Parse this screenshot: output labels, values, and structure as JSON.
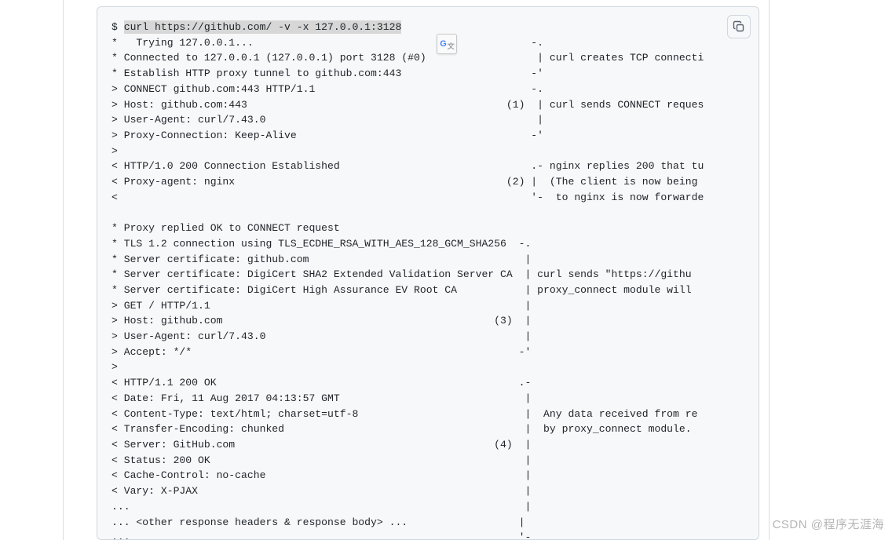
{
  "prompt": "$ ",
  "command_highlight": "curl https://github.com/ -v -x 127.0.0.1:3128",
  "terminal_lines": [
    "*   Trying 127.0.0.1...                                             -.",
    "* Connected to 127.0.0.1 (127.0.0.1) port 3128 (#0)                  | curl creates TCP connecti",
    "* Establish HTTP proxy tunnel to github.com:443                     -'",
    "> CONNECT github.com:443 HTTP/1.1                                   -.",
    "> Host: github.com:443                                          (1)  | curl sends CONNECT reques",
    "> User-Agent: curl/7.43.0                                            |",
    "> Proxy-Connection: Keep-Alive                                      -'",
    ">",
    "< HTTP/1.0 200 Connection Established                               .- nginx replies 200 that tu",
    "< Proxy-agent: nginx                                            (2) |  (The client is now being ",
    "<                                                                   '-  to nginx is now forwarde",
    "",
    "* Proxy replied OK to CONNECT request",
    "* TLS 1.2 connection using TLS_ECDHE_RSA_WITH_AES_128_GCM_SHA256  -.",
    "* Server certificate: github.com                                   |",
    "* Server certificate: DigiCert SHA2 Extended Validation Server CA  | curl sends \"https://githu",
    "* Server certificate: DigiCert High Assurance EV Root CA           | proxy_connect module will",
    "> GET / HTTP/1.1                                                   |",
    "> Host: github.com                                            (3)  |",
    "> User-Agent: curl/7.43.0                                          |",
    "> Accept: */*                                                     -'",
    ">",
    "< HTTP/1.1 200 OK                                                 .-",
    "< Date: Fri, 11 Aug 2017 04:13:57 GMT                              |",
    "< Content-Type: text/html; charset=utf-8                           |  Any data received from re",
    "< Transfer-Encoding: chunked                                       |  by proxy_connect module.",
    "< Server: GitHub.com                                          (4)  |",
    "< Status: 200 OK                                                   |",
    "< Cache-Control: no-cache                                          |",
    "< Vary: X-PJAX                                                     |",
    "...                                                                |",
    "... <other response headers & response body> ...                  |",
    "...                                                               '-"
  ],
  "translate_badge": {
    "g": "G",
    "sub": "文"
  },
  "watermark": "CSDN @程序无涯海"
}
